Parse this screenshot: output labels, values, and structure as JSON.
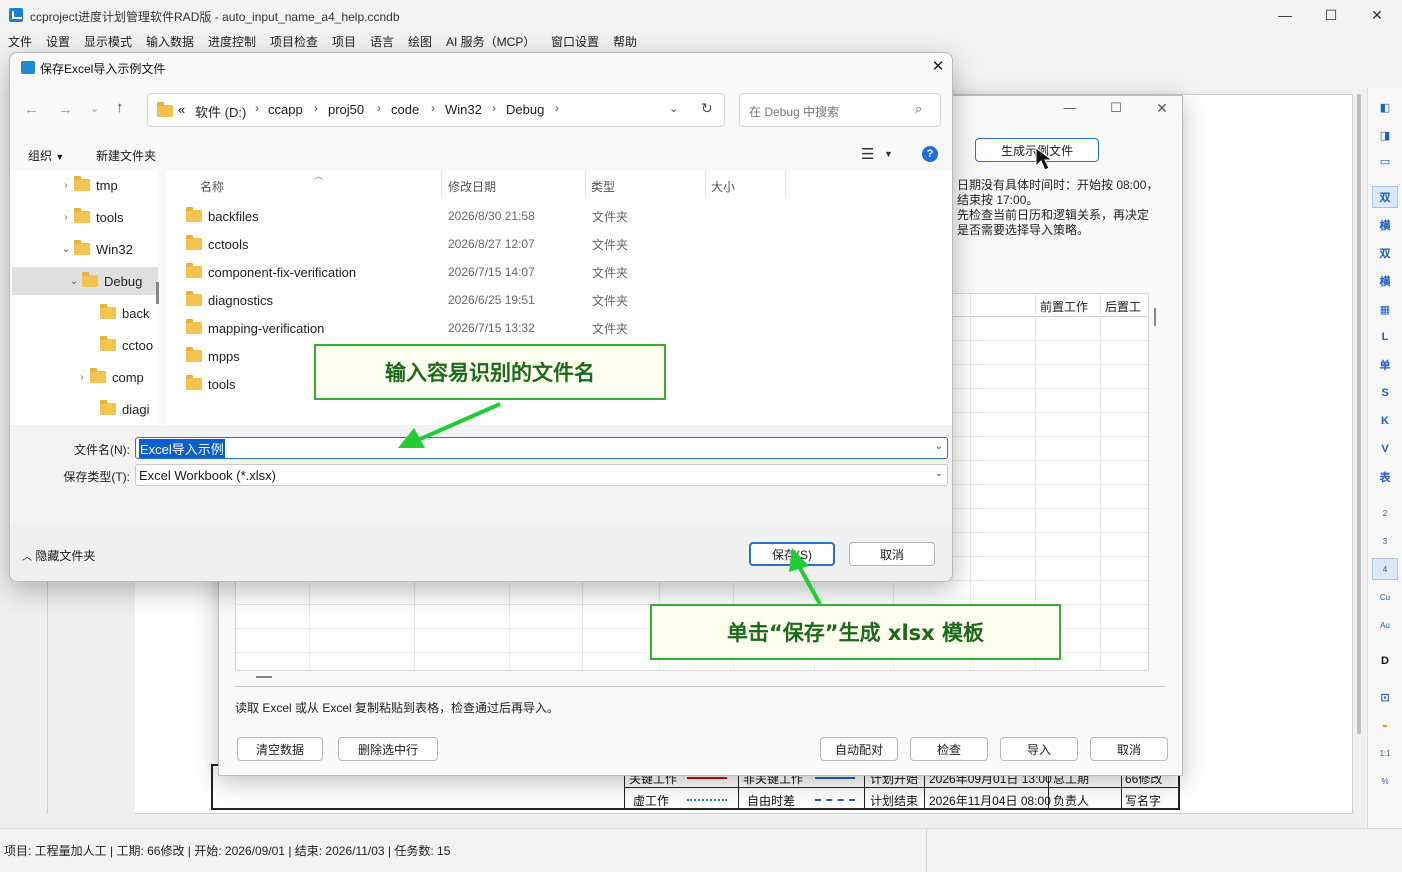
{
  "app": {
    "title": "ccproject进度计划管理软件RAD版 - auto_input_name_a4_help.ccndb",
    "minimize": "—",
    "maximize": "☐",
    "close": "✕"
  },
  "menu": [
    "文件",
    "设置",
    "显示模式",
    "输入数据",
    "进度控制",
    "项目检查",
    "项目",
    "语言",
    "绘图",
    "AI 服务（MCP）",
    "窗口设置",
    "帮助"
  ],
  "right_panel": {
    "buttons": [
      "双",
      "横",
      "双",
      "横",
      "L",
      "单",
      "S",
      "K",
      "V",
      "表",
      "2",
      "3",
      "4",
      "Cu",
      "Au",
      "D",
      "1:1",
      "%"
    ]
  },
  "import_dialog": {
    "generate_button": "生成示例文件",
    "info_text": [
      "日期没有具体时间时：开始按 08:00，",
      "结束按 17:00。",
      "先检查当前日历和逻辑关系，再决定",
      "是否需要选择导入策略。"
    ],
    "grid_headers": [
      "前置工作",
      "后置工"
    ],
    "hint": "读取 Excel 或从 Excel 复制粘贴到表格，检查通过后再导入。",
    "buttons": {
      "clear": "清空数据",
      "delete_rows": "删除选中行",
      "auto_match": "自动配对",
      "check": "检查",
      "import": "导入",
      "cancel": "取消"
    }
  },
  "legend": {
    "row1": [
      "关键工作",
      "非关键工作",
      "计划开始",
      "2026年09月01日 13:00",
      "总工期",
      "66修改"
    ],
    "row2": [
      "虚工作",
      "自由时差",
      "计划结束",
      "2026年11月04日 08:00",
      "负责人",
      "写名字"
    ]
  },
  "save_dialog": {
    "title": "保存Excel导入示例文件",
    "breadcrumb": [
      "«",
      "软件 (D:)",
      "ccapp",
      "proj50",
      "code",
      "Win32",
      "Debug"
    ],
    "search_placeholder": "在 Debug 中搜索",
    "organize": "组织",
    "new_folder": "新建文件夹",
    "nav_items": [
      "tmp",
      "tools",
      "Win32",
      "Debug",
      "back",
      "cctoo",
      "comp",
      "diagi"
    ],
    "columns": [
      "名称",
      "修改日期",
      "类型",
      "大小"
    ],
    "files": [
      {
        "name": "backfiles",
        "date": "2026/8/30 21:58",
        "type": "文件夹"
      },
      {
        "name": "cctools",
        "date": "2026/8/27 12:07",
        "type": "文件夹"
      },
      {
        "name": "component-fix-verification",
        "date": "2026/7/15 14:07",
        "type": "文件夹"
      },
      {
        "name": "diagnostics",
        "date": "2026/6/25 19:51",
        "type": "文件夹"
      },
      {
        "name": "mapping-verification",
        "date": "2026/7/15 13:32",
        "type": "文件夹"
      },
      {
        "name": "mpps",
        "date": "",
        "type": ""
      },
      {
        "name": "tools",
        "date": "",
        "type": ""
      }
    ],
    "filename_label": "文件名(N):",
    "filename_value": "Excel导入示例",
    "filetype_label": "保存类型(T):",
    "filetype_value": "Excel Workbook (*.xlsx)",
    "hide_folders": "隐藏文件夹",
    "save_button": "保存(S)",
    "cancel_button": "取消"
  },
  "callouts": {
    "filename_tip": "输入容易识别的文件名",
    "save_tip": "单击“保存”生成 xlsx 模板"
  },
  "status": "项目: 工程量加人工 | 工期: 66修改 | 开始: 2026/09/01 | 结束: 2026/11/03 | 任务数: 15",
  "colors": {
    "accent": "#0a5fd0",
    "callout_border": "#33b033",
    "callout_text": "#1a6a1a",
    "arrow": "#22cc33"
  }
}
